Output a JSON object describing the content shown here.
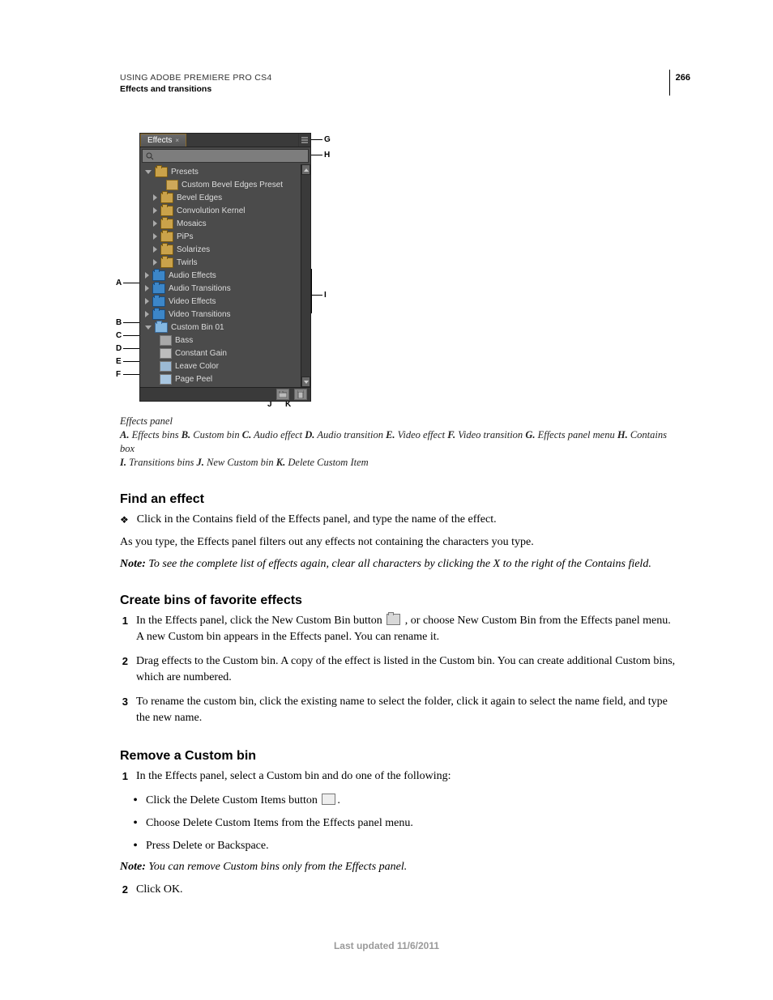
{
  "header": {
    "title": "USING ADOBE PREMIERE PRO CS4",
    "section": "Effects and transitions",
    "page": "266"
  },
  "panel": {
    "tab": "Effects",
    "tree": {
      "presets": "Presets",
      "preset_item": "Custom Bevel Edges Preset",
      "bevel": "Bevel Edges",
      "conv": "Convolution Kernel",
      "mosaics": "Mosaics",
      "pips": "PiPs",
      "solarizes": "Solarizes",
      "twirls": "Twirls",
      "audio_fx": "Audio Effects",
      "audio_tr": "Audio Transitions",
      "video_fx": "Video Effects",
      "video_tr": "Video Transitions",
      "custom_bin": "Custom Bin 01",
      "bass": "Bass",
      "cgain": "Constant Gain",
      "leave": "Leave Color",
      "peel": "Page Peel"
    }
  },
  "callouts": {
    "A": "A",
    "B": "B",
    "C": "C",
    "D": "D",
    "E": "E",
    "F": "F",
    "G": "G",
    "H": "H",
    "I": "I",
    "J": "J",
    "K": "K"
  },
  "caption": {
    "title": "Effects panel",
    "legend_parts": {
      "a_l": "A.",
      "a_t": " Effects bins ",
      "b_l": "B.",
      "b_t": " Custom bin ",
      "c_l": "C.",
      "c_t": " Audio effect ",
      "d_l": "D.",
      "d_t": " Audio transition ",
      "e_l": "E.",
      "e_t": " Video effect ",
      "f_l": "F.",
      "f_t": " Video transition ",
      "g_l": "G.",
      "g_t": " Effects panel menu ",
      "h_l": "H.",
      "h_t": " Contains box ",
      "i_l": "I.",
      "i_t": " Transitions bins ",
      "j_l": "J.",
      "j_t": " New Custom bin ",
      "k_l": "K.",
      "k_t": " Delete Custom Item"
    }
  },
  "s1": {
    "h": "Find an effect",
    "b1": "Click in the Contains field of the Effects panel, and type the name of the effect.",
    "p1": "As you type, the Effects panel filters out any effects not containing the characters you type.",
    "note_l": "Note:",
    "note_t": " To see the complete list of effects again, clear all characters by clicking the X to the right of the Contains field."
  },
  "s2": {
    "h": "Create bins of favorite effects",
    "n1a": "In the Effects panel, click the New Custom Bin button ",
    "n1b": " , or choose New Custom Bin from the Effects panel menu. A new Custom bin appears in the Effects panel. You can rename it.",
    "n2": "Drag effects to the Custom bin. A copy of the effect is listed in the Custom bin. You can create additional Custom bins, which are numbered.",
    "n3": "To rename the custom bin, click the existing name to select the folder, click it again to select the name field, and type the new name."
  },
  "s3": {
    "h": "Remove a Custom bin",
    "n1": "In the Effects panel, select a Custom bin and do one of the following:",
    "d1a": "Click the Delete Custom Items button ",
    "d1b": ".",
    "d2": "Choose Delete Custom Items from the Effects panel menu.",
    "d3": "Press Delete or Backspace.",
    "note_l": "Note:",
    "note_t": " You can remove Custom bins only from the Effects panel.",
    "n2": "Click OK."
  },
  "nums": {
    "one": "1",
    "two": "2",
    "three": "3"
  },
  "footer": "Last updated 11/6/2011"
}
